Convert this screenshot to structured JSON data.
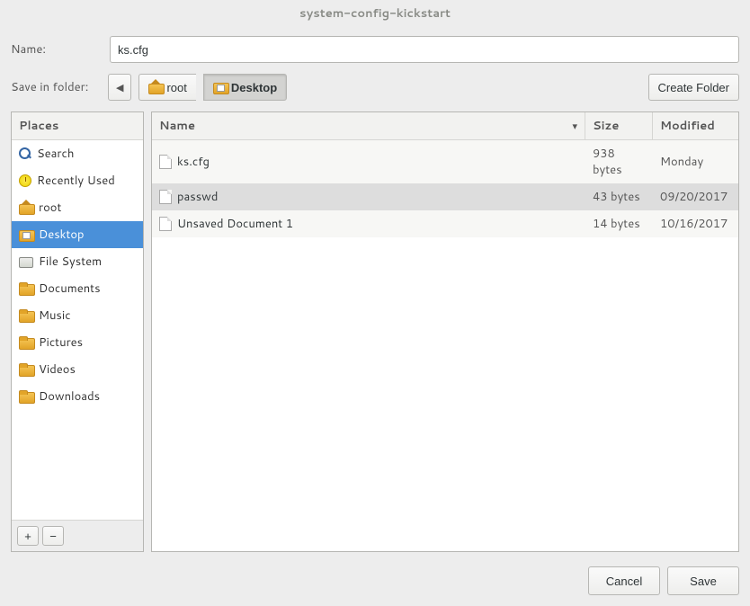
{
  "title": "system-config-kickstart",
  "name_label": "Name:",
  "name_value": "ks.cfg",
  "save_in_label": "Save in folder:",
  "path": [
    "root",
    "Desktop"
  ],
  "create_folder_label": "Create Folder",
  "sidebar": {
    "header": "Places",
    "items": [
      {
        "label": "Search",
        "icon": "search"
      },
      {
        "label": "Recently Used",
        "icon": "clock"
      },
      {
        "label": "root",
        "icon": "home"
      },
      {
        "label": "Desktop",
        "icon": "photo",
        "selected": true
      },
      {
        "label": "File System",
        "icon": "drive"
      },
      {
        "label": "Documents",
        "icon": "folder"
      },
      {
        "label": "Music",
        "icon": "folder"
      },
      {
        "label": "Pictures",
        "icon": "folder"
      },
      {
        "label": "Videos",
        "icon": "folder"
      },
      {
        "label": "Downloads",
        "icon": "folder"
      }
    ]
  },
  "columns": {
    "name": "Name",
    "size": "Size",
    "modified": "Modified"
  },
  "files": [
    {
      "name": "ks.cfg",
      "size": "938 bytes",
      "modified": "Monday"
    },
    {
      "name": "passwd",
      "size": "43 bytes",
      "modified": "09/20/2017",
      "selected": true
    },
    {
      "name": "Unsaved Document 1",
      "size": "14 bytes",
      "modified": "10/16/2017"
    }
  ],
  "buttons": {
    "cancel": "Cancel",
    "save": "Save",
    "add": "+",
    "remove": "−"
  }
}
